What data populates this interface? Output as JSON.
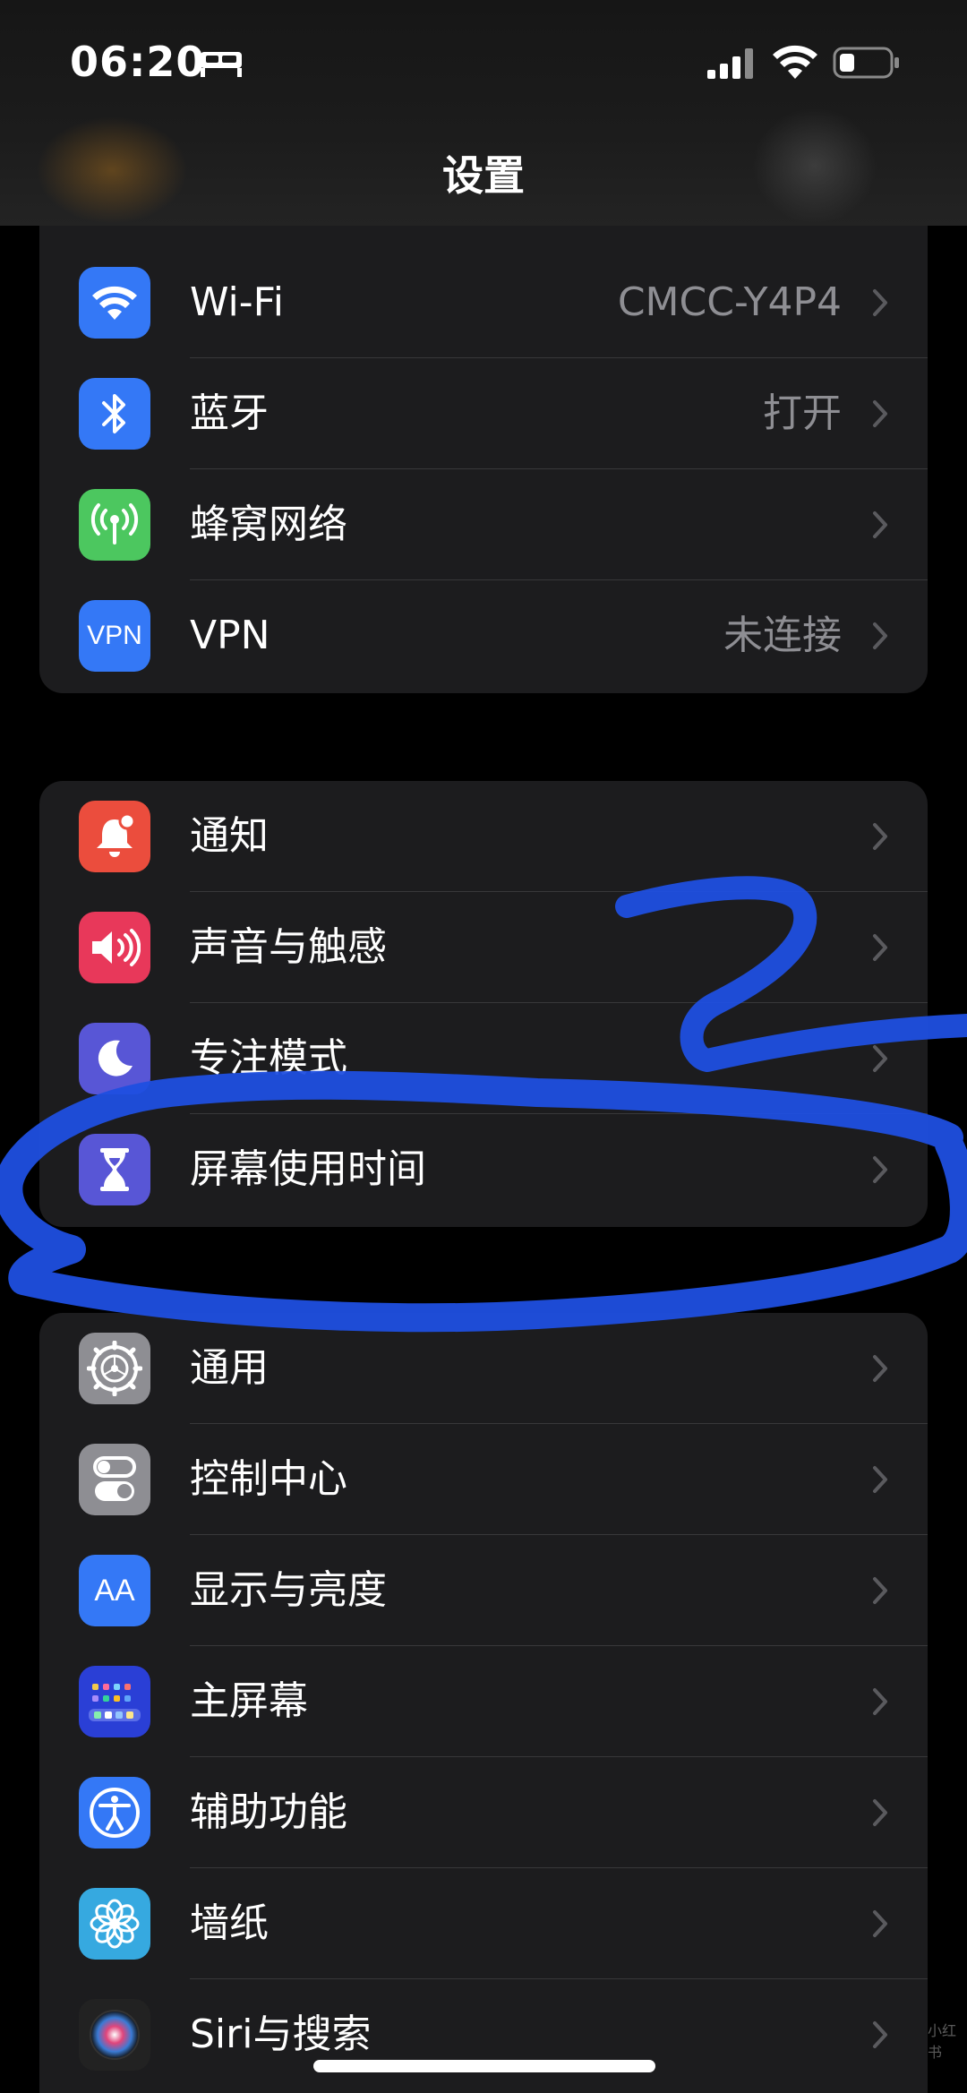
{
  "status_bar": {
    "time": "06:20",
    "icons": [
      "bed-icon",
      "signal-icon",
      "wifi-icon",
      "battery-icon"
    ]
  },
  "nav": {
    "title": "设置"
  },
  "groups": [
    {
      "rows": [
        {
          "label": "Wi-Fi",
          "value": "CMCC-Y4P4",
          "icon": "wifi-icon",
          "color": "#3478f6"
        },
        {
          "label": "蓝牙",
          "value": "打开",
          "icon": "bluetooth-icon",
          "color": "#3478f6"
        },
        {
          "label": "蜂窝网络",
          "value": "",
          "icon": "cellular-antenna-icon",
          "color": "#4cc75f"
        },
        {
          "label": "VPN",
          "value": "未连接",
          "icon": "vpn-icon",
          "icon_text": "VPN",
          "color": "#3478f6"
        }
      ]
    },
    {
      "rows": [
        {
          "label": "通知",
          "value": "",
          "icon": "bell-icon",
          "color": "#eb4d3d"
        },
        {
          "label": "声音与触感",
          "value": "",
          "icon": "speaker-icon",
          "color": "#e8385a"
        },
        {
          "label": "专注模式",
          "value": "",
          "icon": "moon-icon",
          "color": "#5856d6"
        },
        {
          "label": "屏幕使用时间",
          "value": "",
          "icon": "hourglass-icon",
          "color": "#5856d6"
        }
      ]
    },
    {
      "rows": [
        {
          "label": "通用",
          "value": "",
          "icon": "gear-icon",
          "color": "#8e8e93"
        },
        {
          "label": "控制中心",
          "value": "",
          "icon": "toggles-icon",
          "color": "#8e8e93"
        },
        {
          "label": "显示与亮度",
          "value": "",
          "icon": "text-size-icon",
          "icon_text": "AA",
          "color": "#3478f6"
        },
        {
          "label": "主屏幕",
          "value": "",
          "icon": "home-screen-grid-icon",
          "color": "#2a3fd6"
        },
        {
          "label": "辅助功能",
          "value": "",
          "icon": "accessibility-icon",
          "color": "#3478f6"
        },
        {
          "label": "墙纸",
          "value": "",
          "icon": "flower-icon",
          "color": "#36a9e0"
        },
        {
          "label": "Siri与搜索",
          "value": "",
          "icon": "siri-icon",
          "color": "#222222"
        }
      ]
    }
  ],
  "colors": {
    "background": "#000000",
    "group_bg": "#1c1c1e",
    "separator": "#38383a",
    "secondary_text": "#8e8e93",
    "scribble": "#1f4fe0"
  },
  "watermark": "小红书"
}
